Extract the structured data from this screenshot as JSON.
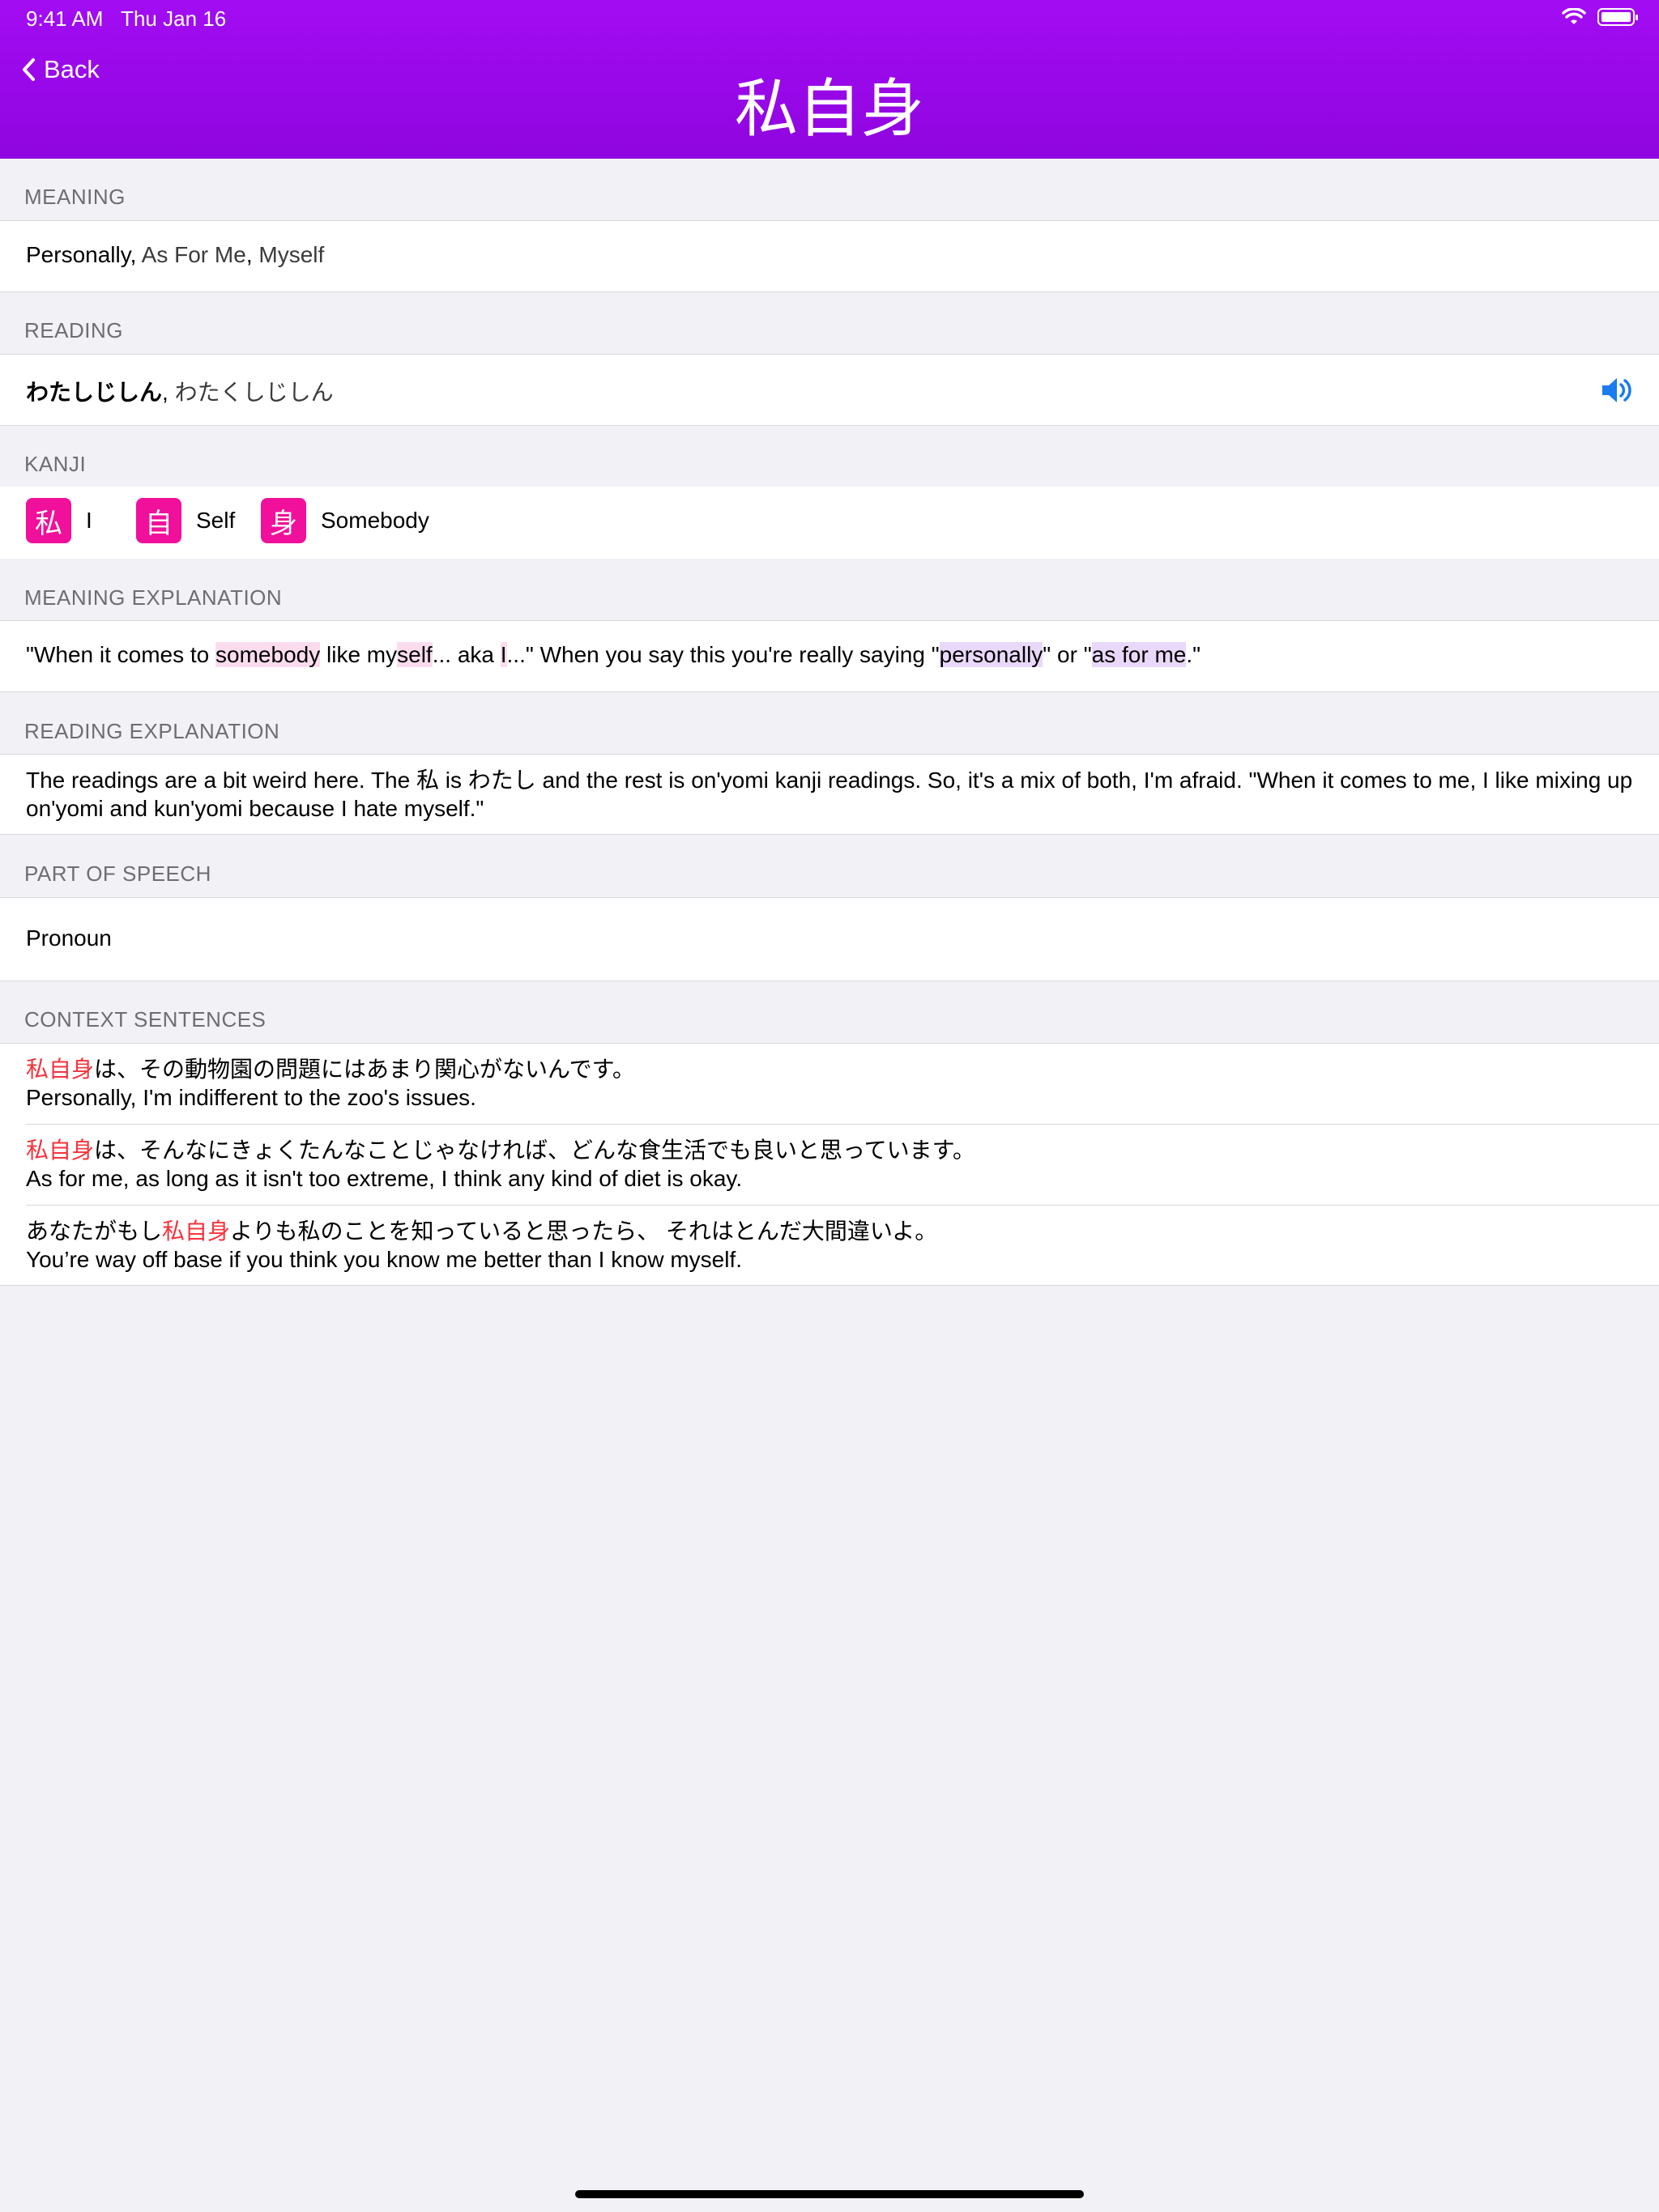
{
  "status": {
    "time": "9:41 AM",
    "date": "Thu Jan 16"
  },
  "nav": {
    "back_label": "Back",
    "title": "私自身"
  },
  "meaning": {
    "header": "MEANING",
    "primary": "Personally",
    "sep1": ",",
    "alt1": " As For Me",
    "sep2": ",",
    "alt2": " Myself"
  },
  "reading": {
    "header": "READING",
    "primary": "わたしじしん",
    "sep": ",",
    "alt": " わたくしじしん"
  },
  "kanji": {
    "header": "KANJI",
    "items": [
      {
        "char": "私",
        "meaning": "I"
      },
      {
        "char": "自",
        "meaning": "Self"
      },
      {
        "char": "身",
        "meaning": "Somebody"
      }
    ]
  },
  "meaning_explanation": {
    "header": "MEANING EXPLANATION",
    "p1": "\"When it comes to ",
    "h1": "somebody",
    "p2": " like my",
    "h2": "self",
    "p3": "... aka ",
    "h3": "I",
    "p4": "...\" When you say this you're really saying \"",
    "h4": "personally",
    "p5": "\" or \"",
    "h5": "as for me",
    "p6": ".\""
  },
  "reading_explanation": {
    "header": "READING EXPLANATION",
    "text": "The readings are a bit weird here. The 私 is わたし and the rest is on'yomi kanji readings. So, it's a mix of both, I'm afraid. \"When it comes to me, I like mixing up on'yomi and kun'yomi because I hate myself.\""
  },
  "part_of_speech": {
    "header": "PART OF SPEECH",
    "value": "Pronoun"
  },
  "context_sentences": {
    "header": "CONTEXT SENTENCES",
    "items": [
      {
        "pre": "",
        "word": "私自身",
        "post": "は、その動物園の問題にはあまり関心がないんです。",
        "en": "Personally, I'm indifferent to the zoo's issues."
      },
      {
        "pre": "",
        "word": "私自身",
        "post": "は、そんなにきょくたんなことじゃなければ、どんな食生活でも良いと思っています。",
        "en": "As for me, as long as it isn't too extreme, I think any kind of diet is okay."
      },
      {
        "pre": "あなたがもし",
        "word": "私自身",
        "post": "よりも私のことを知っていると思ったら、 それはとんだ大間違いよ。",
        "en": "You’re way off base if you think you know me better than I know myself."
      }
    ]
  },
  "colors": {
    "header_purple": "#9a08ea",
    "kanji_pink": "#f0109b",
    "accent_red": "#f5333c",
    "speaker_blue": "#1a7cf0"
  }
}
